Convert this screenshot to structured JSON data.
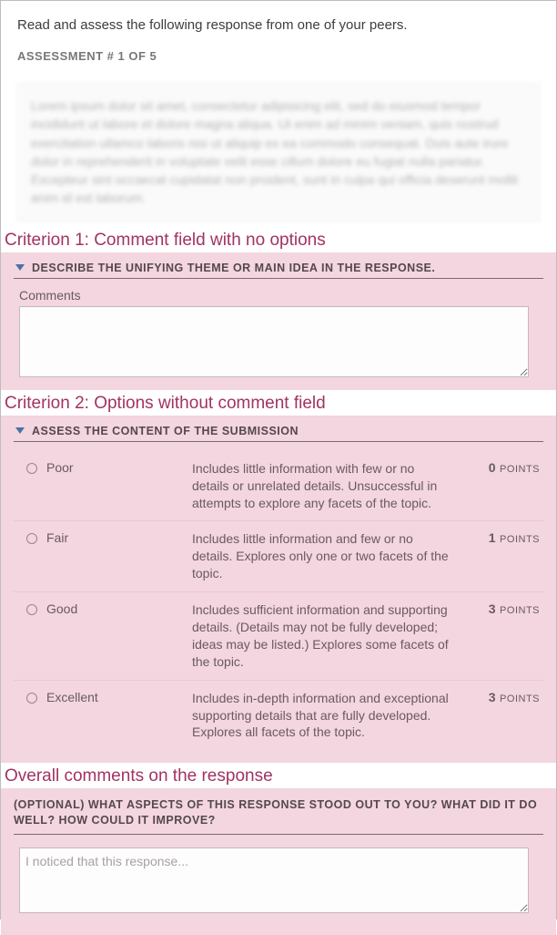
{
  "top": {
    "instruction": "Read and assess the following response from one of your peers.",
    "assessment_label": "ASSESSMENT # 1 OF 5"
  },
  "response_blur_text": "Lorem ipsum dolor sit amet, consectetur adipisicing elit, sed do eiusmod tempor incididunt ut labore et dolore magna aliqua. Ut enim ad minim veniam, quis nostrud exercitation ullamco laboris nisi ut aliquip ex ea commodo consequat. Duis aute irure dolor in reprehenderit in voluptate velit esse cillum dolore eu fugiat nulla pariatur. Excepteur sint occaecat cupidatat non proident, sunt in culpa qui officia deserunt mollit anim id est laborum.",
  "annotations": {
    "crit1": "Criterion 1: Comment field with no options",
    "crit2": "Criterion 2: Options without comment field",
    "overall": "Overall comments on the response"
  },
  "criteria": {
    "crit1": {
      "title": "DESCRIBE THE UNIFYING THEME OR MAIN IDEA IN THE RESPONSE.",
      "comments_label": "Comments"
    },
    "crit2": {
      "title": "ASSESS THE CONTENT OF THE SUBMISSION",
      "points_word": "POINTS",
      "options": [
        {
          "label": "Poor",
          "desc": "Includes little information with few or no details or unrelated details. Unsuccessful in attempts to explore any facets of the topic.",
          "points": "0"
        },
        {
          "label": "Fair",
          "desc": "Includes little information and few or no details. Explores only one or two facets of the topic.",
          "points": "1"
        },
        {
          "label": "Good",
          "desc": "Includes sufficient information and supporting details. (Details may not be fully developed; ideas may be listed.) Explores some facets of the topic.",
          "points": "3"
        },
        {
          "label": "Excellent",
          "desc": "Includes in-depth information and exceptional supporting details that are fully developed. Explores all facets of the topic.",
          "points": "3"
        }
      ]
    }
  },
  "overall": {
    "heading": "(OPTIONAL) WHAT ASPECTS OF THIS RESPONSE STOOD OUT TO YOU? WHAT DID IT DO WELL? HOW COULD IT IMPROVE?",
    "placeholder": "I noticed that this response..."
  }
}
